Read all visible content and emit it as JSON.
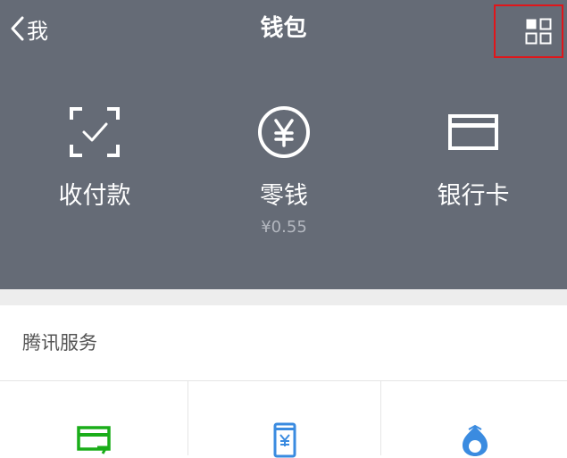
{
  "nav": {
    "back_label": "我",
    "title": "钱包",
    "more_icon": "grid-menu-icon"
  },
  "actions": [
    {
      "label": "收付款",
      "icon": "scan-check-icon"
    },
    {
      "label": "零钱",
      "icon": "yuan-circle-icon",
      "sub": "¥0.55"
    },
    {
      "label": "银行卡",
      "icon": "bank-card-icon"
    }
  ],
  "section": {
    "title": "腾讯服务",
    "items": [
      {
        "icon": "credit-card-repay-icon"
      },
      {
        "icon": "mobile-topup-icon"
      },
      {
        "icon": "wealth-management-icon"
      }
    ]
  },
  "colors": {
    "header_bg": "#656b76",
    "highlight_border": "#e0161a",
    "green": "#1aad19",
    "blue": "#3a8be0"
  }
}
